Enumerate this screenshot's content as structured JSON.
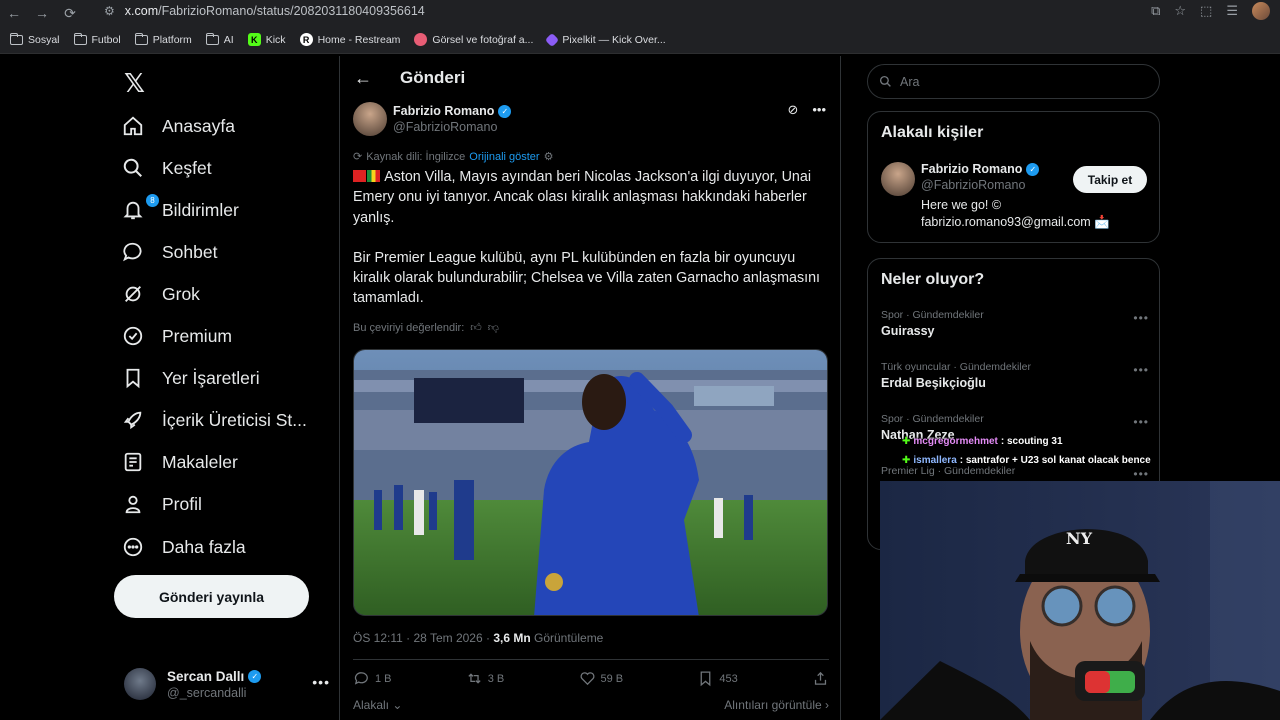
{
  "browser": {
    "url_host": "x.com",
    "url_path": "/FabrizioRomano/status/2082031180409356614",
    "bookmarks": [
      {
        "label": "Sosyal",
        "icon": "folder-icon"
      },
      {
        "label": "Futbol",
        "icon": "folder-icon"
      },
      {
        "label": "Platform",
        "icon": "folder-icon"
      },
      {
        "label": "AI",
        "icon": "folder-icon"
      },
      {
        "label": "Kick",
        "icon": "kick-icon"
      },
      {
        "label": "Home - Restream",
        "icon": "restream-icon"
      },
      {
        "label": "Görsel ve fotoğraf a...",
        "icon": "image-icon"
      },
      {
        "label": "Pixelkit — Kick Over...",
        "icon": "pixelkit-icon"
      }
    ]
  },
  "sidebar": {
    "items": [
      {
        "label": "Anasayfa",
        "icon": "home-icon"
      },
      {
        "label": "Keşfet",
        "icon": "search-icon"
      },
      {
        "label": "Bildirimler",
        "icon": "bell-icon",
        "badge": "8"
      },
      {
        "label": "Sohbet",
        "icon": "chat-icon"
      },
      {
        "label": "Grok",
        "icon": "grok-icon"
      },
      {
        "label": "Premium",
        "icon": "premium-icon"
      },
      {
        "label": "Yer İşaretleri",
        "icon": "bookmark-icon"
      },
      {
        "label": "İçerik Üreticisi St...",
        "icon": "rocket-icon"
      },
      {
        "label": "Makaleler",
        "icon": "article-icon"
      },
      {
        "label": "Profil",
        "icon": "profile-icon"
      },
      {
        "label": "Daha fazla",
        "icon": "more-circle-icon"
      }
    ],
    "post_button": "Gönderi yayınla",
    "account": {
      "name": "Sercan Dallı",
      "handle": "@_sercandalli"
    }
  },
  "main": {
    "header_title": "Gönderi",
    "author": {
      "name": "Fabrizio Romano",
      "handle": "@FabrizioRomano"
    },
    "source_lang_label": "Kaynak dili: İngilizce",
    "show_original": "Orijinali göster",
    "paragraph1": "Aston Villa, Mayıs ayından beri Nicolas Jackson'a ilgi duyuyor, Unai Emery onu iyi tanıyor. Ancak olası kiralık anlaşması hakkındaki haberler yanlış.",
    "paragraph2": "Bir Premier League kulübü, aynı PL kulübünden en fazla bir oyuncuyu kiralık olarak bulundurabilir; Chelsea ve Villa zaten Garnacho anlaşmasını tamamladı.",
    "rate_label": "Bu çeviriyi değerlendir:",
    "timestamp": "ÖS 12:11 · 28 Tem 2026 · ",
    "views_value": "3,6 Mn",
    "views_label": " Görüntüleme",
    "replies": "1 B",
    "reposts": "3 B",
    "likes": "59 B",
    "bookmarks": "453",
    "relevant_label": "Alakalı",
    "quotes_label": "Alıntıları görüntüle"
  },
  "right": {
    "search_placeholder": "Ara",
    "related_title": "Alakalı kişiler",
    "related_user": {
      "name": "Fabrizio Romano",
      "handle": "@FabrizioRomano",
      "bio": "Here we go! © fabrizio.romano93@gmail.com 📩",
      "follow_label": "Takip et"
    },
    "trends_title": "Neler oluyor?",
    "trends": [
      {
        "category": "Spor · Gündemdekiler",
        "name": "Guirassy"
      },
      {
        "category": "Türk oyuncular · Gündemdekiler",
        "name": "Erdal Beşikçioğlu"
      },
      {
        "category": "Spor · Gündemdekiler",
        "name": "Nathan Zeze"
      },
      {
        "category": "Premier Lig · Gündemdekiler",
        "name": ""
      }
    ]
  },
  "stream_chat": [
    {
      "user": "mcgregormehmet",
      "message": ": scouting 31"
    },
    {
      "user": "ismallera",
      "message": ": santrafor + U23 sol kanat olacak bence"
    }
  ]
}
